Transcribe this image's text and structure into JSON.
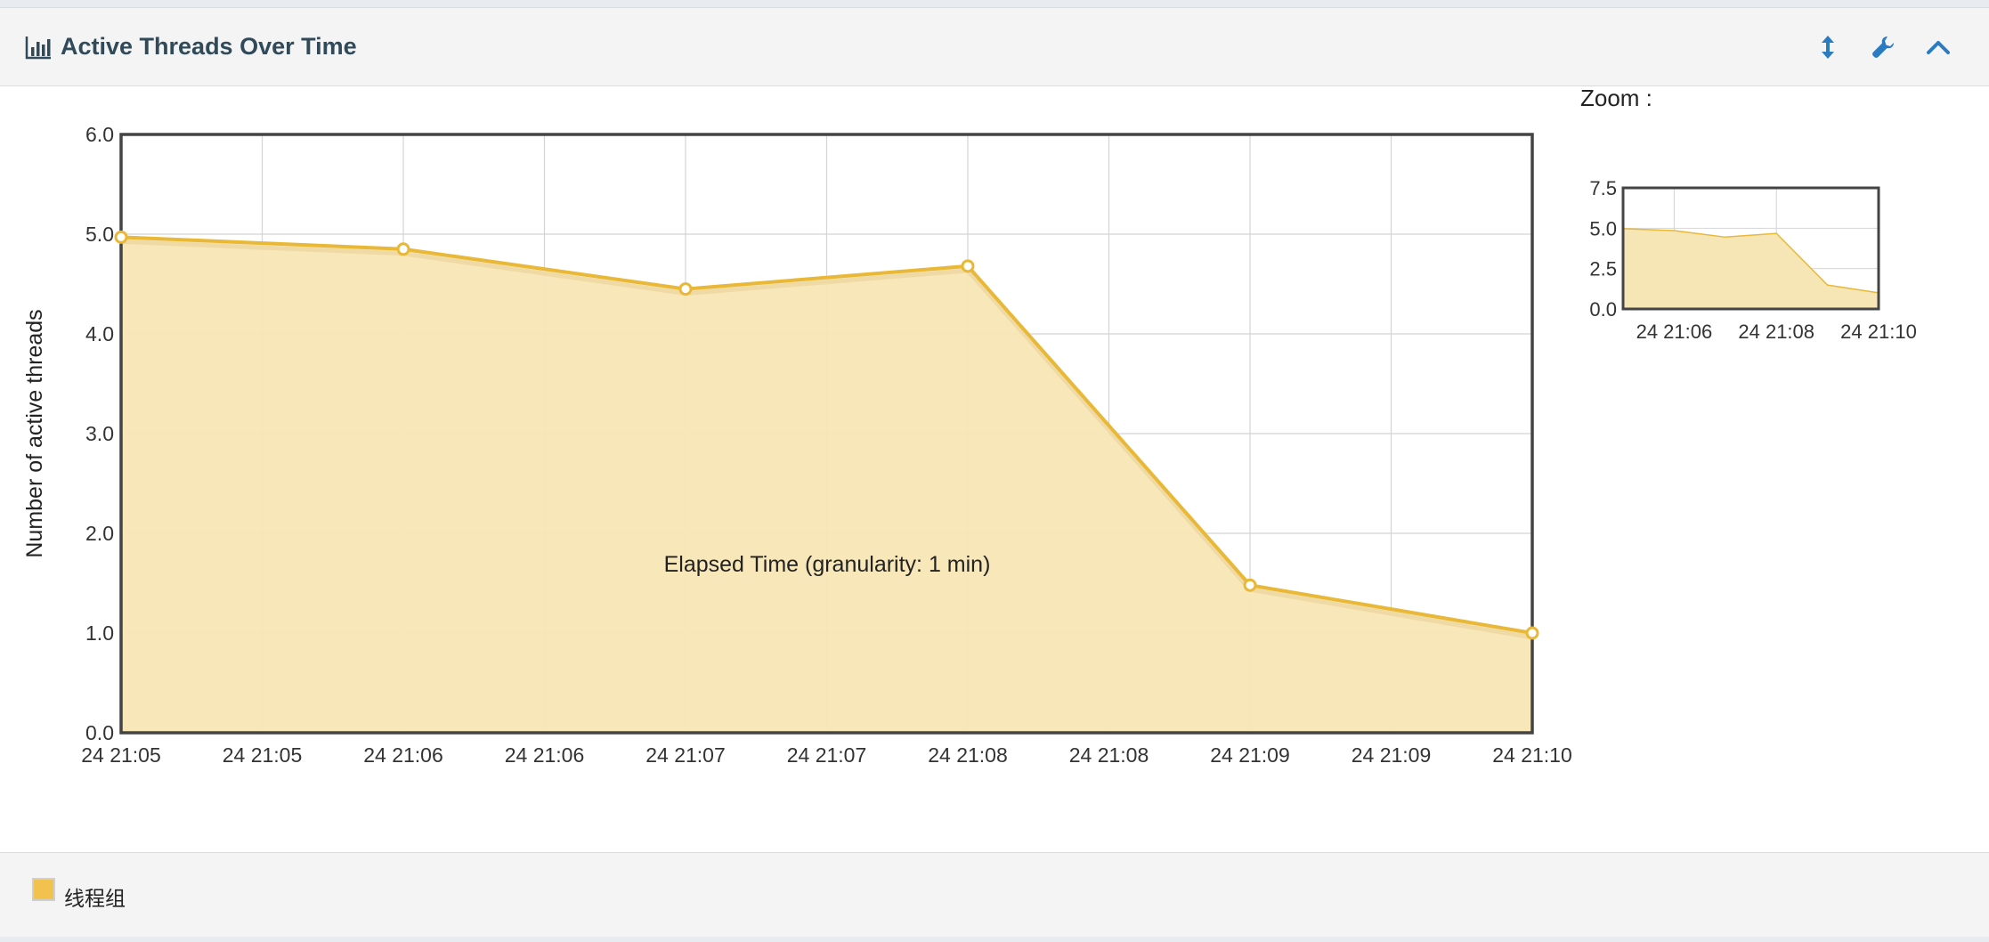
{
  "panel": {
    "title": "Active Threads Over Time",
    "title_icon": "bar-chart-icon",
    "tools": [
      {
        "name": "resize-vertical-icon",
        "label": "resize"
      },
      {
        "name": "wrench-icon",
        "label": "settings"
      },
      {
        "name": "chevron-up-icon",
        "label": "collapse"
      }
    ]
  },
  "colors": {
    "series": "#f1c34e",
    "series_line": "#e8b836",
    "fill": "#f7e6b5",
    "header_text": "#304a5a",
    "icon_blue": "#2a7bbf"
  },
  "chart_data": {
    "type": "area",
    "title": "",
    "xlabel": "Elapsed Time (granularity: 1 min)",
    "ylabel": "Number of active threads",
    "x": [
      0,
      1,
      2,
      3,
      4,
      5
    ],
    "x_tick_labels": [
      "24 21:05",
      "24 21:05",
      "24 21:06",
      "24 21:06",
      "24 21:07",
      "24 21:07",
      "24 21:08",
      "24 21:08",
      "24 21:09",
      "24 21:09",
      "24 21:10"
    ],
    "ylim": [
      0,
      6
    ],
    "y_ticks": [
      "0.0",
      "1.0",
      "2.0",
      "3.0",
      "4.0",
      "5.0",
      "6.0"
    ],
    "grid": true,
    "legend_position": "bottom",
    "series": [
      {
        "name": "线程组",
        "values": [
          4.97,
          4.85,
          4.45,
          4.68,
          1.48,
          1.0
        ]
      }
    ]
  },
  "zoom": {
    "label": "Zoom :",
    "ylim": [
      0,
      7.5
    ],
    "y_ticks": [
      "0.0",
      "2.5",
      "5.0",
      "7.5"
    ],
    "x_tick_labels": [
      "24 21:06",
      "24 21:08",
      "24 21:10"
    ]
  },
  "legend": {
    "items": [
      {
        "label": "线程组",
        "color": "#f1c34e"
      }
    ]
  }
}
